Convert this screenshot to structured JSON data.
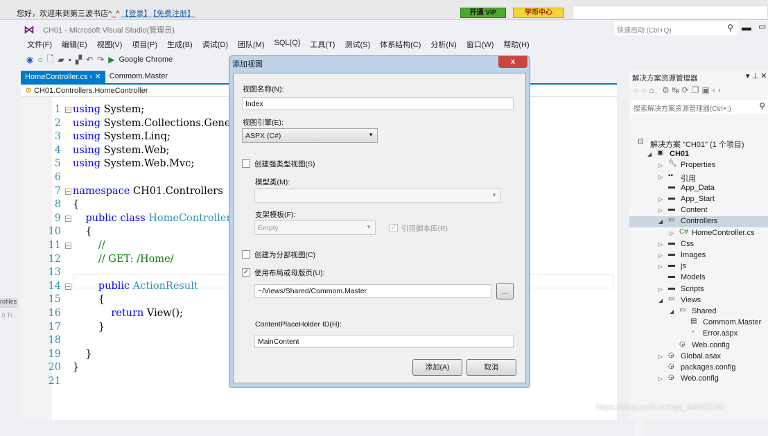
{
  "browser": {
    "welcome": "您好，欢迎来到第三波书店^_^",
    "login": "【登录】",
    "register": "【免费注册】",
    "vip": "开通 VIP",
    "coin": "学币中心"
  },
  "window": {
    "title": "CH01 - Microsoft Visual Studio(管理员)",
    "quick_launch": "快速启动 (Ctrl+Q)"
  },
  "menu": [
    "文件(F)",
    "编辑(E)",
    "视图(V)",
    "项目(P)",
    "生成(B)",
    "调试(D)",
    "团队(M)",
    "SQL(Q)",
    "工具(T)",
    "测试(S)",
    "体系结构(C)",
    "分析(N)",
    "窗口(W)",
    "帮助(H)"
  ],
  "toolbar": {
    "run_label": "Google Chrome"
  },
  "tabs": [
    {
      "label": "HomeController.cs",
      "active": true
    },
    {
      "label": "Commom.Master",
      "active": false
    }
  ],
  "breadcrumb": "CH01.Controllers.HomeController",
  "code": [
    {
      "n": "1",
      "fold": "⊟",
      "tokens": [
        {
          "k": "kw",
          "t": "using"
        },
        {
          "k": "plain",
          "t": " System;"
        }
      ]
    },
    {
      "n": "2",
      "tokens": [
        {
          "k": "kw",
          "t": "using"
        },
        {
          "k": "plain",
          "t": " System.Collections.Generic;"
        }
      ]
    },
    {
      "n": "3",
      "tokens": [
        {
          "k": "kw",
          "t": "using"
        },
        {
          "k": "plain",
          "t": " System.Linq;"
        }
      ]
    },
    {
      "n": "4",
      "tokens": [
        {
          "k": "kw",
          "t": "using"
        },
        {
          "k": "plain",
          "t": " System.Web;"
        }
      ]
    },
    {
      "n": "5",
      "tokens": [
        {
          "k": "kw",
          "t": "using"
        },
        {
          "k": "plain",
          "t": " System.Web.Mvc;"
        }
      ]
    },
    {
      "n": "6",
      "tokens": []
    },
    {
      "n": "7",
      "fold": "⊟",
      "tokens": [
        {
          "k": "kw",
          "t": "namespace"
        },
        {
          "k": "plain",
          "t": " CH01.Controllers"
        }
      ]
    },
    {
      "n": "8",
      "tokens": [
        {
          "k": "plain",
          "t": "{"
        }
      ]
    },
    {
      "n": "9",
      "fold": "⊟",
      "tokens": [
        {
          "k": "plain",
          "t": "    "
        },
        {
          "k": "kw",
          "t": "public class"
        },
        {
          "k": "type",
          "t": " HomeController"
        }
      ]
    },
    {
      "n": "10",
      "tokens": [
        {
          "k": "plain",
          "t": "    {"
        }
      ]
    },
    {
      "n": "11",
      "fold": "⊟",
      "tokens": [
        {
          "k": "comment",
          "t": "        //"
        }
      ]
    },
    {
      "n": "12",
      "tokens": [
        {
          "k": "comment",
          "t": "        // GET: /Home/"
        }
      ]
    },
    {
      "n": "13",
      "tokens": []
    },
    {
      "n": "14",
      "fold": "⊟",
      "tokens": [
        {
          "k": "plain",
          "t": "        "
        },
        {
          "k": "kw",
          "t": "public"
        },
        {
          "k": "type",
          "t": " ActionResult"
        }
      ]
    },
    {
      "n": "15",
      "tokens": [
        {
          "k": "plain",
          "t": "        {"
        }
      ]
    },
    {
      "n": "16",
      "tokens": [
        {
          "k": "plain",
          "t": "            "
        },
        {
          "k": "kw",
          "t": "return"
        },
        {
          "k": "plain",
          "t": " View();"
        }
      ]
    },
    {
      "n": "17",
      "tokens": [
        {
          "k": "plain",
          "t": "        }"
        }
      ]
    },
    {
      "n": "18",
      "tokens": []
    },
    {
      "n": "19",
      "tokens": [
        {
          "k": "plain",
          "t": "    }"
        }
      ]
    },
    {
      "n": "20",
      "tokens": [
        {
          "k": "plain",
          "t": "}"
        }
      ]
    },
    {
      "n": "21",
      "tokens": []
    }
  ],
  "left_stub": {
    "a": "rofiles",
    "b": ".0 Tr"
  },
  "dialog": {
    "title": "添加视图",
    "close": "x",
    "view_name_label": "视图名称(N):",
    "view_name": "Index",
    "engine_label": "视图引擎(E):",
    "engine": "ASPX (C#)",
    "strong_typed_label": "创建强类型视图(S)",
    "strong_typed": false,
    "model_label": "模型类(M):",
    "model": "",
    "scaffold_label": "支架模板(F):",
    "scaffold": "Empty",
    "ref_scripts_label": "引用脚本库(R)",
    "ref_scripts": true,
    "partial_label": "创建为分部视图(C)",
    "partial": false,
    "layout_label": "使用布局或母版页(U):",
    "layout": true,
    "layout_path": "~/Views/Shared/Commom.Master",
    "browse": "...",
    "placeholder_label": "ContentPlaceHolder ID(H):",
    "placeholder_id": "MainContent",
    "add": "添加(A)",
    "cancel": "取消"
  },
  "solution": {
    "title": "解决方案资源管理器",
    "search": "搜索解决方案资源管理器(Ctrl+;)",
    "items": [
      {
        "label": "解决方案 \"CH01\" (1 个项目)",
        "lvl": 0,
        "exp": "",
        "icon": "solution-icon"
      },
      {
        "label": "CH01",
        "lvl": 1,
        "exp": "◢",
        "icon": "project-icon",
        "bold": true
      },
      {
        "label": "Properties",
        "lvl": 2,
        "exp": "▷",
        "icon": "wrench-icon"
      },
      {
        "label": "引用",
        "lvl": 2,
        "exp": "▷",
        "icon": "references-icon"
      },
      {
        "label": "App_Data",
        "lvl": 2,
        "exp": "",
        "icon": "folder-icon"
      },
      {
        "label": "App_Start",
        "lvl": 2,
        "exp": "▷",
        "icon": "folder-icon"
      },
      {
        "label": "Content",
        "lvl": 2,
        "exp": "▷",
        "icon": "folder-icon"
      },
      {
        "label": "Controllers",
        "lvl": 2,
        "exp": "◢",
        "icon": "folder-open-icon",
        "selected": true
      },
      {
        "label": "HomeController.cs",
        "lvl": 3,
        "exp": "▷",
        "icon": "csharp-file-icon"
      },
      {
        "label": "Css",
        "lvl": 2,
        "exp": "▷",
        "icon": "folder-icon"
      },
      {
        "label": "Images",
        "lvl": 2,
        "exp": "▷",
        "icon": "folder-icon"
      },
      {
        "label": "js",
        "lvl": 2,
        "exp": "▷",
        "icon": "folder-icon"
      },
      {
        "label": "Models",
        "lvl": 2,
        "exp": "",
        "icon": "folder-icon"
      },
      {
        "label": "Scripts",
        "lvl": 2,
        "exp": "▷",
        "icon": "folder-icon"
      },
      {
        "label": "Views",
        "lvl": 2,
        "exp": "◢",
        "icon": "folder-open-icon"
      },
      {
        "label": "Shared",
        "lvl": 3,
        "exp": "◢",
        "icon": "folder-open-icon"
      },
      {
        "label": "Commom.Master",
        "lvl": 4,
        "exp": "",
        "icon": "master-page-icon"
      },
      {
        "label": "Error.aspx",
        "lvl": 4,
        "exp": "",
        "icon": "aspx-file-icon"
      },
      {
        "label": "Web.config",
        "lvl": 3,
        "exp": "",
        "icon": "config-file-icon"
      },
      {
        "label": "Global.asax",
        "lvl": 2,
        "exp": "▷",
        "icon": "config-file-icon"
      },
      {
        "label": "packages.config",
        "lvl": 2,
        "exp": "",
        "icon": "config-file-icon"
      },
      {
        "label": "Web.config",
        "lvl": 2,
        "exp": "▷",
        "icon": "config-file-icon"
      }
    ]
  },
  "watermark": "https://blog.csdn.net/qq_44658169"
}
